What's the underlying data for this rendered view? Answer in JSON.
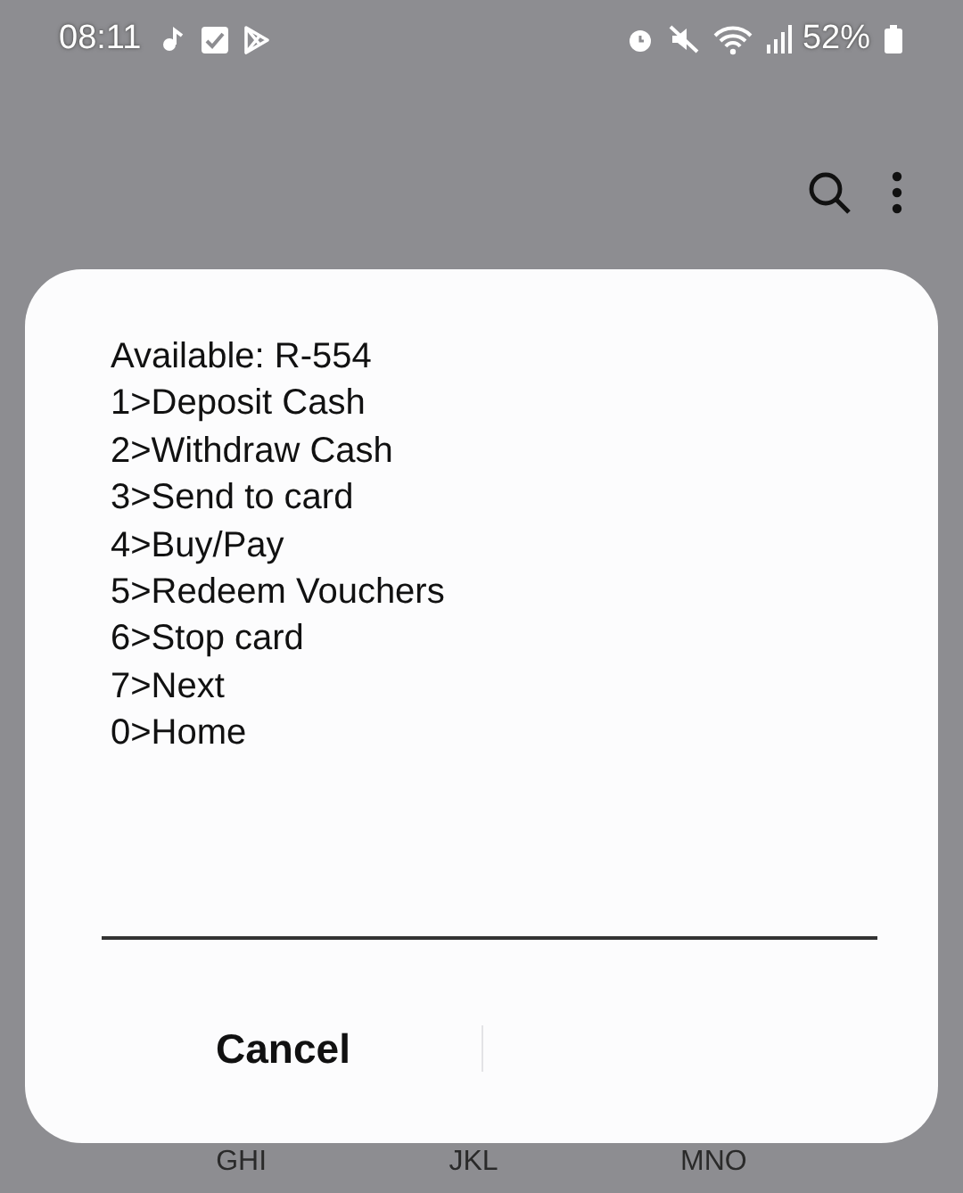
{
  "status_bar": {
    "time": "08:11",
    "battery": "52%"
  },
  "dialog": {
    "lines": [
      "Available: R-554",
      "1>Deposit Cash",
      "2>Withdraw Cash",
      "3>Send to card",
      "4>Buy/Pay",
      "5>Redeem Vouchers",
      "6>Stop card",
      "7>Next",
      "0>Home"
    ],
    "buttons": [
      "Cancel"
    ]
  },
  "keypad_letters": [
    "GHI",
    "JKL",
    "MNO"
  ]
}
